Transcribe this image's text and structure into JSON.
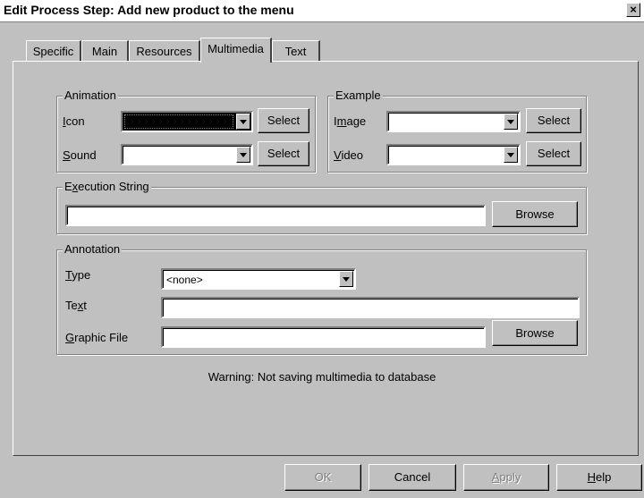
{
  "window": {
    "title": "Edit Process Step: Add new product to the menu",
    "close": "×"
  },
  "tabs": [
    {
      "label": "Specific"
    },
    {
      "label": "Main"
    },
    {
      "label": "Resources"
    },
    {
      "label": "Multimedia"
    },
    {
      "label": "Text"
    }
  ],
  "animation": {
    "legend": "Animation",
    "icon_label": "Icon",
    "icon_value": "",
    "icon_select": "Select",
    "sound_label": "Sound",
    "sound_value": "",
    "sound_select": "Select"
  },
  "example": {
    "legend": "Example",
    "image_label": "Image",
    "image_value": "",
    "image_select": "Select",
    "video_label": "Video",
    "video_value": "",
    "video_select": "Select"
  },
  "execution": {
    "legend": "Execution String",
    "value": "",
    "browse": "Browse"
  },
  "annotation": {
    "legend": "Annotation",
    "type_label": "Type",
    "type_value": "<none>",
    "text_label": "Text",
    "text_value": "",
    "graphic_label": "Graphic File",
    "graphic_value": "",
    "browse": "Browse"
  },
  "warning": "Warning: Not saving multimedia to database",
  "buttons": {
    "ok": "OK",
    "cancel": "Cancel",
    "apply": "Apply",
    "help": "Help"
  }
}
